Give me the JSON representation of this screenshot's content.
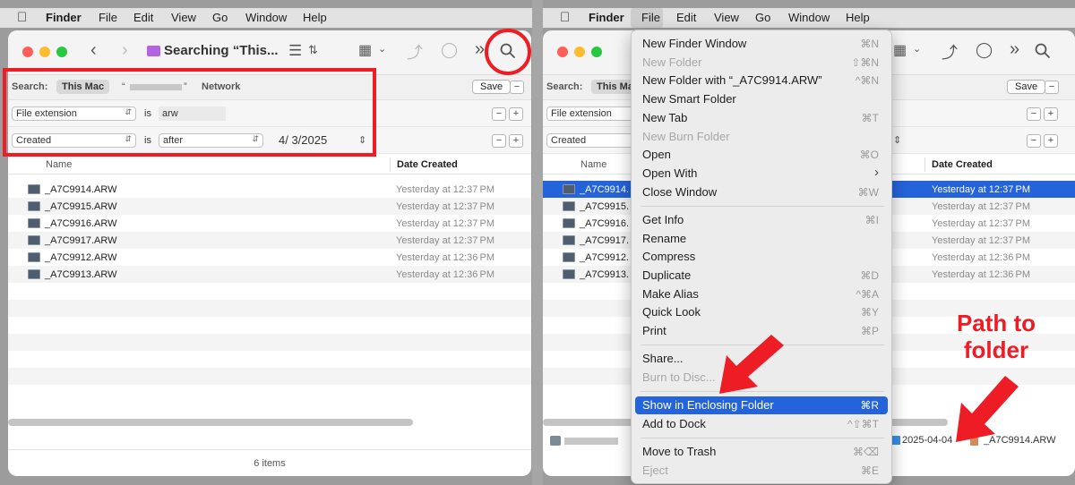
{
  "colors": {
    "accent": "#2463d9",
    "annotation": "#ee1c24",
    "traffic_red": "#fe5f57",
    "traffic_yellow": "#febc2e",
    "traffic_green": "#28c840"
  },
  "menubar": {
    "app_name": "Finder",
    "items": [
      "File",
      "Edit",
      "View",
      "Go",
      "Window",
      "Help"
    ],
    "apple_icon": "apple-icon"
  },
  "toolbar": {
    "title": "Searching “This...",
    "icons": [
      "back-icon",
      "forward-icon",
      "folder-icon",
      "list-view-icon",
      "icon-grid-icon",
      "share-icon",
      "tag-icon",
      "more-icon",
      "search-icon"
    ]
  },
  "search": {
    "label": "Search:",
    "scope_this_mac": "This Mac",
    "scope_quote_open": "“",
    "scope_quote_close": "”",
    "scope_network": "Network",
    "save_label": "Save",
    "minus": "−",
    "plus": "+"
  },
  "criteria": [
    {
      "attribute": "File extension",
      "operator": "is",
      "value": "arw"
    },
    {
      "attribute": "Created",
      "operator": "is",
      "qualifier": "after",
      "value": "4/ 3/2025"
    }
  ],
  "columns": {
    "name": "Name",
    "date_created": "Date Created"
  },
  "files": [
    {
      "name": "_A7C9914.ARW",
      "date": "Yesterday at 12:37 PM"
    },
    {
      "name": "_A7C9915.ARW",
      "date": "Yesterday at 12:37 PM"
    },
    {
      "name": "_A7C9916.ARW",
      "date": "Yesterday at 12:37 PM"
    },
    {
      "name": "_A7C9917.ARW",
      "date": "Yesterday at 12:37 PM"
    },
    {
      "name": "_A7C9912.ARW",
      "date": "Yesterday at 12:36 PM"
    },
    {
      "name": "_A7C9913.ARW",
      "date": "Yesterday at 12:36 PM"
    }
  ],
  "files_truncated": [
    "_A7C9914.",
    "_A7C9915.",
    "_A7C9916.",
    "_A7C9917.",
    "_A7C9912.",
    "_A7C9913."
  ],
  "status": {
    "count": "6 items"
  },
  "path_bar": {
    "folder": "2025-04-04",
    "separator": "›",
    "file": "_A7C9914.ARW"
  },
  "file_menu": [
    {
      "label": "New Finder Window",
      "shortcut": "⌘N"
    },
    {
      "label": "New Folder",
      "shortcut": "⇧⌘N",
      "disabled": true
    },
    {
      "label": "New Folder with “_A7C9914.ARW”",
      "shortcut": "^⌘N"
    },
    {
      "label": "New Smart Folder",
      "shortcut": ""
    },
    {
      "label": "New Tab",
      "shortcut": "⌘T"
    },
    {
      "label": "New Burn Folder",
      "shortcut": "",
      "disabled": true
    },
    {
      "label": "Open",
      "shortcut": "⌘O"
    },
    {
      "label": "Open With",
      "shortcut": "›"
    },
    {
      "label": "Close Window",
      "shortcut": "⌘W"
    },
    {
      "separator": true
    },
    {
      "label": "Get Info",
      "shortcut": "⌘I"
    },
    {
      "label": "Rename",
      "shortcut": ""
    },
    {
      "label": "Compress",
      "shortcut": ""
    },
    {
      "label": "Duplicate",
      "shortcut": "⌘D"
    },
    {
      "label": "Make Alias",
      "shortcut": "^⌘A"
    },
    {
      "label": "Quick Look",
      "shortcut": "⌘Y"
    },
    {
      "label": "Print",
      "shortcut": "⌘P"
    },
    {
      "separator": true
    },
    {
      "label": "Share...",
      "shortcut": ""
    },
    {
      "label": "Burn to Disc...",
      "shortcut": "",
      "disabled": true
    },
    {
      "separator": true
    },
    {
      "label": "Show in Enclosing Folder",
      "shortcut": "⌘R",
      "highlighted": true
    },
    {
      "label": "Add to Dock",
      "shortcut": "^⇧⌘T"
    },
    {
      "separator": true
    },
    {
      "label": "Move to Trash",
      "shortcut": "⌘⌫"
    },
    {
      "label": "Eject",
      "shortcut": "⌘E",
      "disabled": true
    }
  ],
  "annotations": {
    "path_label": [
      "Path to",
      "folder"
    ]
  }
}
